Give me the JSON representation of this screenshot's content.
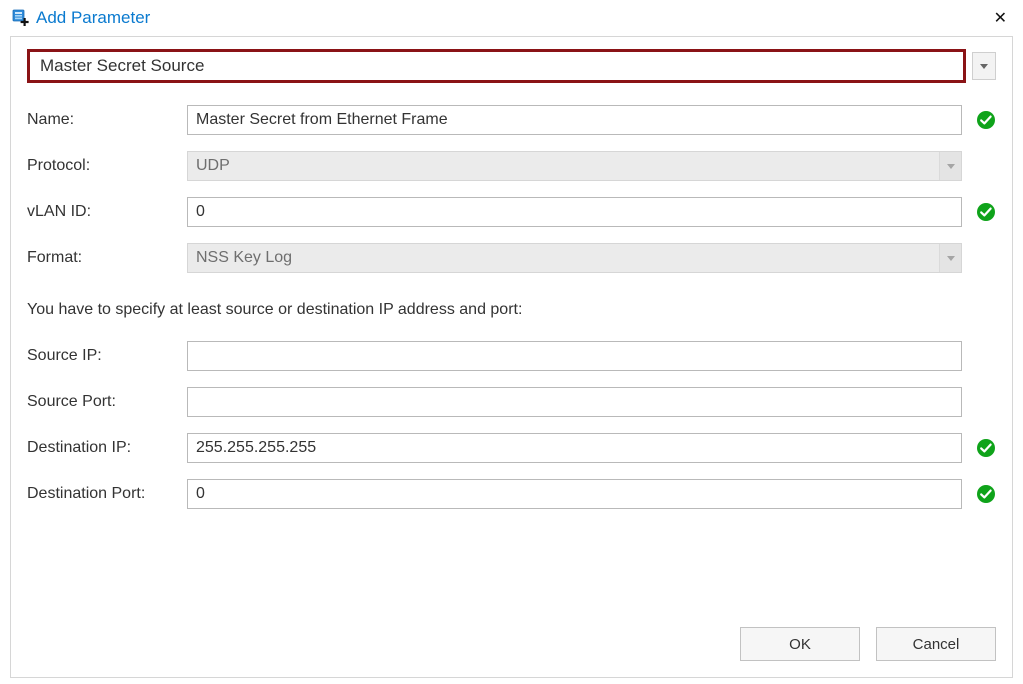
{
  "title": "Add Parameter",
  "top_select": "Master Secret Source",
  "fields": {
    "name": {
      "label": "Name:",
      "value": "Master Secret from Ethernet Frame",
      "valid": true
    },
    "protocol": {
      "label": "Protocol:",
      "value": "UDP",
      "disabled": true
    },
    "vlan": {
      "label": "vLAN ID:",
      "value": "0",
      "valid": true
    },
    "format": {
      "label": "Format:",
      "value": "NSS Key Log",
      "disabled": true
    },
    "source_ip": {
      "label": "Source IP:",
      "value": ""
    },
    "source_port": {
      "label": "Source Port:",
      "value": ""
    },
    "dest_ip": {
      "label": "Destination IP:",
      "value": "255.255.255.255",
      "valid": true
    },
    "dest_port": {
      "label": "Destination Port:",
      "value": "0",
      "valid": true
    }
  },
  "instruction": "You have to specify at least source or destination IP address and port:",
  "buttons": {
    "ok": "OK",
    "cancel": "Cancel"
  }
}
